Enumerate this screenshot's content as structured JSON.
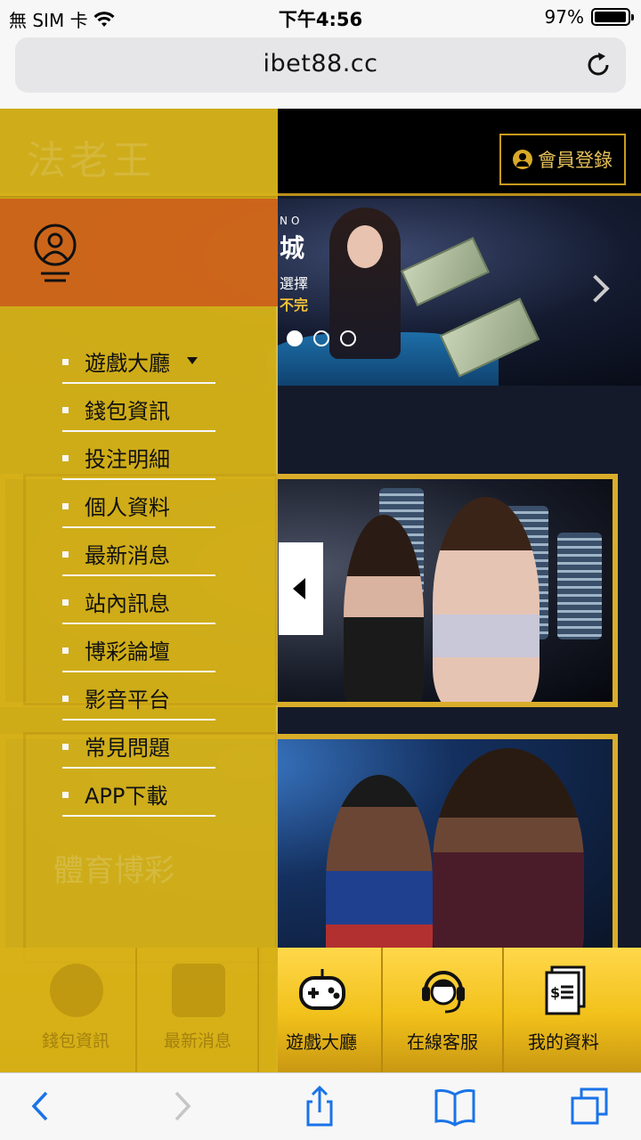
{
  "status_bar": {
    "carrier": "無 SIM 卡",
    "time": "下午4:56",
    "battery_percent": "97%",
    "battery_level": 0.97
  },
  "browser": {
    "url": "ibet88.cc"
  },
  "header": {
    "logo_text": "法老王",
    "login_label": "會員登錄"
  },
  "banner": {
    "side_texts": [
      "NO",
      "城",
      "選擇",
      "不完"
    ],
    "active_slide": 1,
    "slide_count": 3
  },
  "drawer": {
    "menu": [
      {
        "label": "遊戲大廳",
        "has_caret": true
      },
      {
        "label": "錢包資訊"
      },
      {
        "label": "投注明細"
      },
      {
        "label": "個人資料"
      },
      {
        "label": "最新消息"
      },
      {
        "label": "站內訊息"
      },
      {
        "label": "博彩論壇"
      },
      {
        "label": "影音平台"
      },
      {
        "label": "常見問題"
      },
      {
        "label": "APP下載"
      }
    ],
    "ghost_labels": [
      "體育博彩"
    ],
    "tabs": [
      "錢包資訊",
      "最新消息"
    ]
  },
  "tabbar": {
    "items": [
      {
        "label": "遊戲大廳",
        "icon": "gamepad-icon"
      },
      {
        "label": "在線客服",
        "icon": "headset-icon"
      },
      {
        "label": "我的資料",
        "icon": "document-icon"
      }
    ]
  },
  "colors": {
    "drawer_bg": "#d5b118",
    "drawer_user_bg": "#d2681a",
    "accent_gold": "#d9ad2a",
    "tabbar_gold": "#f1c01a"
  }
}
